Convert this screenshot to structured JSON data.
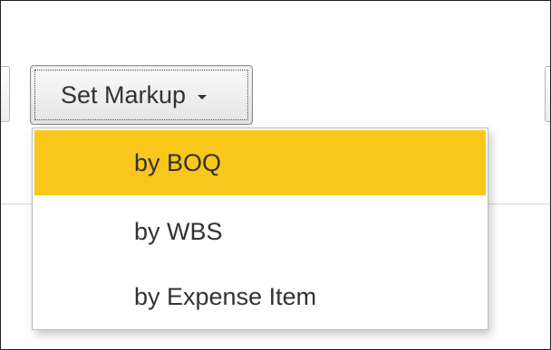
{
  "toolbar": {
    "set_markup_button": {
      "label": "Set Markup",
      "caret_icon": "caret-down-icon"
    }
  },
  "dropdown_menu": {
    "items": [
      {
        "label": "by BOQ",
        "highlighted": true
      },
      {
        "label": "by WBS",
        "highlighted": false
      },
      {
        "label": "by Expense Item",
        "highlighted": false
      }
    ],
    "highlight_color": "#f9c61c"
  },
  "colors": {
    "text": "#333333",
    "button_border": "#8c8c8c",
    "divider": "#d6d6d6",
    "frame_border": "#222222"
  }
}
